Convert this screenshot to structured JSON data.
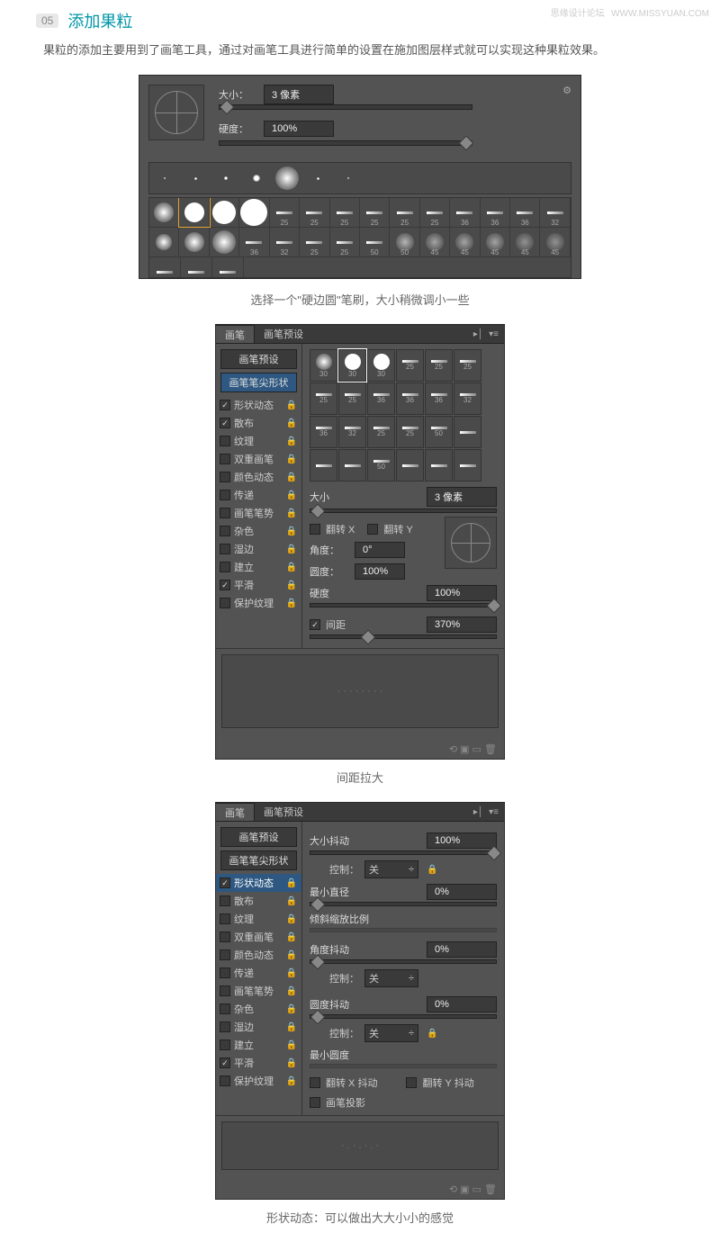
{
  "watermark": {
    "site": "思缘设计论坛",
    "url": "WWW.MISSYUAN.COM"
  },
  "step": {
    "num": "05",
    "title": "添加果粒"
  },
  "body": "果粒的添加主要用到了画笔工具，通过对画笔工具进行简单的设置在施加图层样式就可以实现这种果粒效果。",
  "p1": {
    "size_label": "大小：",
    "size_val": "3 像素",
    "hard_label": "硬度：",
    "hard_val": "100%"
  },
  "cap1": "选择一个\"硬边圆\"笔刷，大小稍微调小一些",
  "tabs": {
    "brush": "画笔",
    "preset": "画笔预设"
  },
  "side": {
    "preset_btn": "画笔预设",
    "tip": "画笔笔尖形状",
    "opts": [
      "形状动态",
      "散布",
      "纹理",
      "双重画笔",
      "颜色动态",
      "传递",
      "画笔笔势",
      "杂色",
      "湿边",
      "建立",
      "平滑",
      "保护纹理"
    ]
  },
  "p2": {
    "thumbs": [
      [
        "30",
        "30",
        "30",
        "25",
        "25",
        "25"
      ],
      [
        "25",
        "25",
        "36",
        "36",
        "36",
        "32"
      ],
      [
        "36",
        "32",
        "25",
        "25",
        "50",
        ""
      ],
      [
        "",
        "",
        "50",
        "",
        "",
        ""
      ]
    ],
    "size_l": "大小",
    "size_v": "3 像素",
    "flipx": "翻转 X",
    "flipy": "翻转 Y",
    "angle_l": "角度：",
    "angle_v": "0°",
    "round_l": "圆度：",
    "round_v": "100%",
    "hard_l": "硬度",
    "hard_v": "100%",
    "spacing_l": "间距",
    "spacing_v": "370%"
  },
  "cap2": "间距拉大",
  "p3": {
    "jitter_l": "大小抖动",
    "jitter_v": "100%",
    "ctrl_l": "控制：",
    "ctrl_v": "关",
    "mindiam_l": "最小直径",
    "mindiam_v": "0%",
    "tilt_l": "倾斜缩放比例",
    "anglej_l": "角度抖动",
    "anglej_v": "0%",
    "roundj_l": "圆度抖动",
    "roundj_v": "0%",
    "minround_l": "最小圆度",
    "flipxj": "翻转 X 抖动",
    "flipyj": "翻转 Y 抖动",
    "proj": "画笔投影"
  },
  "cap3": "形状动态：可以做出大大小小的感觉"
}
